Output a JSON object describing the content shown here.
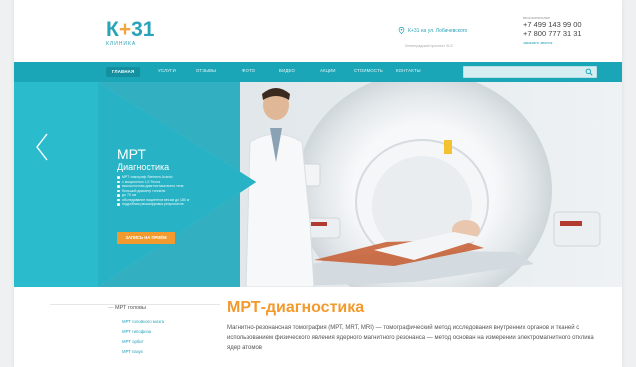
{
  "header": {
    "logo_text": "К",
    "logo_dot": "+",
    "logo_num": "31",
    "logo_sub": "КЛИНИКА",
    "address": "К+31 на ул. Лобачевского",
    "address_note": "Ленинградский проспект 31/2",
    "phones_label": "многоканальные",
    "phone1": "+7 499 143 99 00",
    "phone2": "+7 800 777 31 31",
    "callback": "заказать звонок"
  },
  "nav": {
    "items": [
      "ГЛАВНАЯ",
      "УСЛУГИ",
      "ОТЗЫВЫ",
      "ФОТО",
      "ВИДЕО",
      "АКЦИИ",
      "СТОИМОСТЬ",
      "КОНТАКТЫ"
    ],
    "search_placeholder": ""
  },
  "hero": {
    "title": "МРТ",
    "subtitle": "Диагностика",
    "bullets": [
      "МРТ-томограф Siemens Avanto",
      "с мощностью 1,5 Тесла",
      "высокоточная диагностика всего тела",
      "большой диаметр тоннеля",
      "до 70 см",
      "обследование пациентов весом до 180 кг",
      "подробная расшифровка результатов"
    ],
    "button": "ЗАПИСЬ НА ПРИЁМ"
  },
  "sidebar": {
    "head": "МРТ головы",
    "items": [
      "МРТ головного мозга",
      "МРТ гипофиза",
      "МРТ орбит",
      "МРТ пазух"
    ]
  },
  "main": {
    "title": "МРТ-диагностика",
    "text": "Магнитно-резонансная томография (МРТ, MRT, MRI) — томографический метод исследования внутренних органов и тканей с использованием физического явления ядерного магнитного резонанса — метод основан на измерении электромагнитного отклика ядер атомов"
  },
  "colors": {
    "teal": "#1aa6b7",
    "orange": "#f29a2e"
  }
}
